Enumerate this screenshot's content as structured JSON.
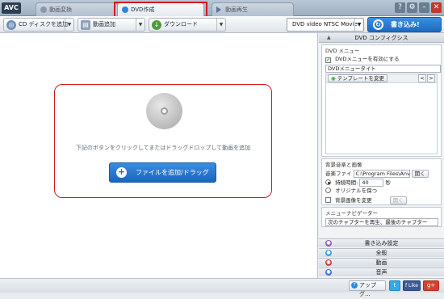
{
  "titlebar": {
    "logo": "AVC",
    "tabs": [
      {
        "label": "動画変換",
        "active": false
      },
      {
        "label": "DVD作成",
        "active": true
      },
      {
        "label": "動画再生",
        "active": false
      }
    ],
    "window_buttons": [
      "?",
      "⚙",
      "–",
      "✕"
    ]
  },
  "toolbar": {
    "cd_button": "CD ディスクを追加",
    "add_video_button": "動画追加",
    "download_button": "ダウンロード",
    "profile": "DVD video NTSC Movie",
    "burn_button": "書き込み!"
  },
  "main": {
    "drop_hint": "下記のボタンをクリックしてまたはドラッグドロップして動画を追加",
    "add_file_button": "ファイルを追加/ドラッグ"
  },
  "panel": {
    "title": "DVD コンフィグシス",
    "dvd_menu": {
      "group_title": "DVD メニュー",
      "enable_menu": "DVDメニューを有効にする",
      "menu_title_label": "DVDメニュータイト",
      "template_button": "テンプレートを変更",
      "prev": "<",
      "next": ">"
    },
    "bgm": {
      "group_title": "背景音楽と画像",
      "music_file_label": "音楽ファイ",
      "music_file_value": "C:\\Program Files\\AnvS",
      "open_button": "開く",
      "duration_label": "持続時間:",
      "duration_value": "40",
      "duration_unit": "秒",
      "keep_original": "オリジナルを保つ",
      "change_bg": "背景画像を変更",
      "open_bg_button": "開く"
    },
    "navigator": {
      "group_title": "メニューナビゲーター",
      "value": "次のチャプターを再生、最後のチャプター"
    },
    "sections": [
      "書き込み設定",
      "全般",
      "動画",
      "音声"
    ]
  },
  "statusbar": {
    "upgrade": "アップグ...",
    "twitter": "t",
    "facebook": "f Like",
    "gplus": "g+"
  }
}
